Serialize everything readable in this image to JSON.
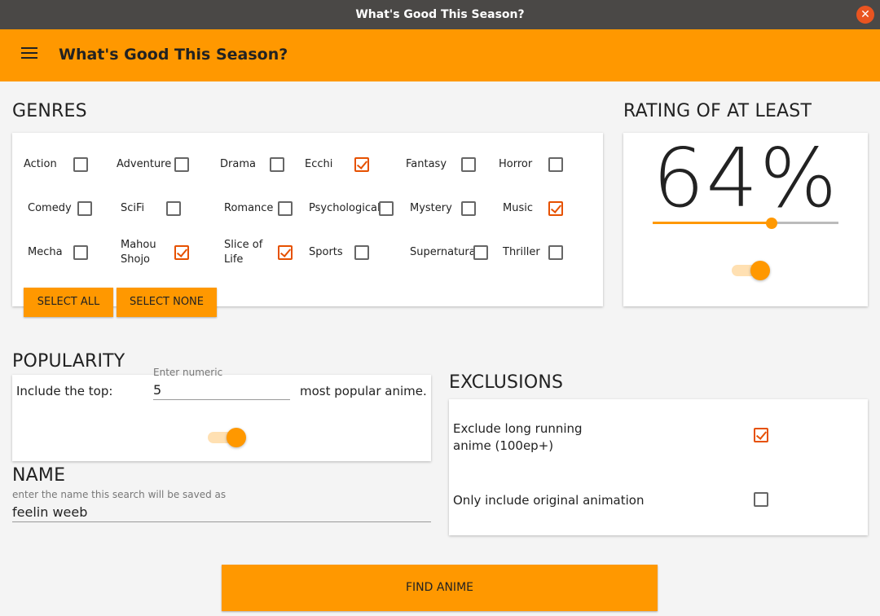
{
  "window": {
    "title": "What's Good This Season?"
  },
  "appbar": {
    "title": "What's Good This Season?"
  },
  "genres": {
    "title": "GENRES",
    "items": [
      {
        "label": "Action",
        "checked": false
      },
      {
        "label": "Adventure",
        "checked": false
      },
      {
        "label": "Drama",
        "checked": false
      },
      {
        "label": "Ecchi",
        "checked": true
      },
      {
        "label": "Fantasy",
        "checked": false
      },
      {
        "label": "Horror",
        "checked": false
      },
      {
        "label": "Comedy",
        "checked": false
      },
      {
        "label": "SciFi",
        "checked": false
      },
      {
        "label": "Romance",
        "checked": false
      },
      {
        "label": "Psychological",
        "checked": false
      },
      {
        "label": "Mystery",
        "checked": false
      },
      {
        "label": "Music",
        "checked": true
      },
      {
        "label": "Mecha",
        "checked": false
      },
      {
        "label": "Mahou Shojo",
        "checked": true
      },
      {
        "label": "Slice of Life",
        "checked": true
      },
      {
        "label": "Sports",
        "checked": false
      },
      {
        "label": "Supernatural",
        "checked": false
      },
      {
        "label": "Thriller",
        "checked": false
      }
    ],
    "select_all": "SELECT ALL",
    "select_none": "SELECT NONE"
  },
  "rating": {
    "title": "RATING OF AT LEAST",
    "value_text": "64%",
    "value": 64,
    "toggle_on": true
  },
  "popularity": {
    "title": "POPULARITY",
    "prefix": "Include the top:",
    "input_hint": "Enter numeric",
    "input_value": "5",
    "suffix": "most popular anime.",
    "toggle_on": true
  },
  "name": {
    "title": "NAME",
    "hint": "enter the name this search will be saved as",
    "value": "feelin weeb"
  },
  "exclusions": {
    "title": "EXCLUSIONS",
    "items": [
      {
        "label": "Exclude long running anime (100ep+)",
        "checked": true
      },
      {
        "label": "Only include original animation",
        "checked": false
      }
    ]
  },
  "find_button": "FIND ANIME",
  "colors": {
    "accent": "#ff9800",
    "check": "#e65100",
    "titlebar": "#4a4846",
    "close": "#e95420"
  }
}
